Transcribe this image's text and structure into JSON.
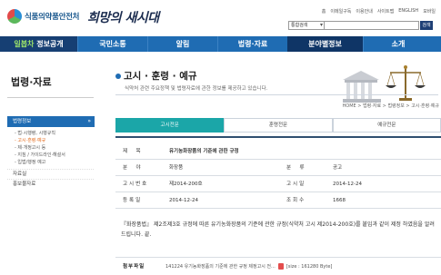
{
  "header": {
    "logo_text": "식품의약품안전처",
    "slogan": "희망의 새시대",
    "util_links": [
      "홈",
      "이메일구독",
      "이용안내",
      "사이트맵",
      "ENGLISH",
      "모바일"
    ],
    "search": {
      "selected": "통합검색",
      "button": "검색"
    }
  },
  "gnb": {
    "first_accent": "일봅차",
    "first_label": " 정보공개",
    "items": [
      "국민소통",
      "알림",
      "법령·자료",
      "분야별정보",
      "소개"
    ]
  },
  "lnb": {
    "title": "법령·자료",
    "active": "법령정보",
    "sub": [
      "법·시행령, 시행규칙",
      "고시·훈령·예규",
      "제·개정고시 등",
      "지침 / 가이드라인·해설서",
      "입법/행정 예고"
    ],
    "items": [
      "자료실",
      "홍보물자료"
    ]
  },
  "content": {
    "title": "고시 · 훈령 · 예규",
    "desc": "식약처 관련 주요정책 및 법령자료에 관한 정보를 제공하고 있습니다.",
    "breadcrumb": "HOME > 법령·자료 > 법령정보 > 고시·훈령·예규"
  },
  "tabs": [
    "고시전문",
    "훈령전문",
    "예규전문"
  ],
  "detail": {
    "rows": {
      "title_h": "제　목",
      "title_v": "유기농화장품의 기준에 관한 규정",
      "field_h": "분　야",
      "field_v": "화장품",
      "type_h": "분　류",
      "type_v": "공고",
      "num_h": "고시번호",
      "num_v": "제2014-200호",
      "date_h": "고시일",
      "date_v": "2014-12-24",
      "reg_h": "등록일",
      "reg_v": "2014-12-24",
      "views_h": "조회수",
      "views_v": "1668"
    },
    "body": "『화장품법』 제2조제3호 규정에 따른 유기농화장품의 기준에 관한 규정(식약처 고시 제2014-200호)를 붙임과 같이 제정 하였음을 알려드립니다. 끝.",
    "attach_label": "첨부파일",
    "attach_file": "141224 유기농화장품의 기준에 관한 규정 제정고시 전...",
    "attach_size": "[size : 161280 Byte]"
  }
}
